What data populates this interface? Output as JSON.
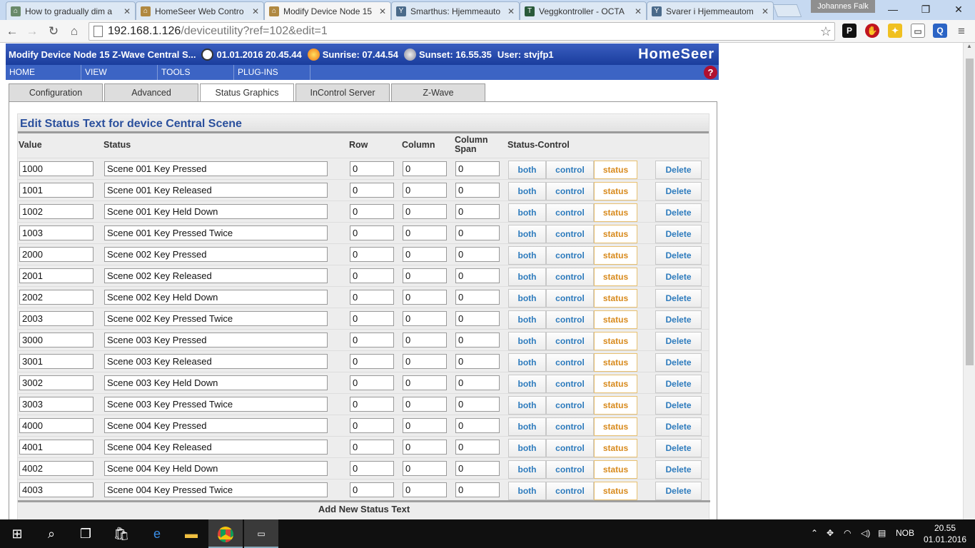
{
  "browser": {
    "tabs": [
      {
        "title": "How to gradually dim a",
        "icon": "homeseer-board-icon"
      },
      {
        "title": "HomeSeer Web Contro",
        "icon": "homeseer-house-icon"
      },
      {
        "title": "Modify Device Node 15",
        "icon": "homeseer-house-icon",
        "active": true
      },
      {
        "title": "Smarthus: Hjemmeauto",
        "icon": "smarthus-icon"
      },
      {
        "title": "Veggkontroller - OCTA",
        "icon": "veggkontroller-icon"
      },
      {
        "title": "Svarer i Hjemmeautom",
        "icon": "smarthus-icon"
      }
    ],
    "user": "Johannes Falk",
    "url_host": "192.168.1.126",
    "url_path": "/deviceutility?ref=102&edit=1"
  },
  "header": {
    "title": "Modify Device Node 15 Z-Wave Central S...",
    "datetime": "01.01.2016 20.45.44",
    "sunrise": "Sunrise: 07.44.54",
    "sunset": "Sunset: 16.55.35",
    "user": "User: stvjfp1",
    "logo": "HomeSeer"
  },
  "menu": [
    "HOME",
    "VIEW",
    "TOOLS",
    "PLUG-INS"
  ],
  "page_tabs": [
    "Configuration",
    "Advanced",
    "Status Graphics",
    "InControl Server",
    "Z-Wave"
  ],
  "section": {
    "title": "Edit Status Text for device Central Scene",
    "columns": {
      "value": "Value",
      "status": "Status",
      "row": "Row",
      "column": "Column",
      "column_span_1": "Column",
      "column_span_2": "Span",
      "status_control": "Status-Control"
    },
    "buttons": {
      "both": "both",
      "control": "control",
      "status": "status",
      "delete": "Delete"
    },
    "rows": [
      {
        "value": "1000",
        "status": "Scene 001 Key Pressed",
        "row": "0",
        "column": "0",
        "span": "0"
      },
      {
        "value": "1001",
        "status": "Scene 001 Key Released",
        "row": "0",
        "column": "0",
        "span": "0"
      },
      {
        "value": "1002",
        "status": "Scene 001 Key Held Down",
        "row": "0",
        "column": "0",
        "span": "0"
      },
      {
        "value": "1003",
        "status": "Scene 001 Key Pressed Twice",
        "row": "0",
        "column": "0",
        "span": "0"
      },
      {
        "value": "2000",
        "status": "Scene 002 Key Pressed",
        "row": "0",
        "column": "0",
        "span": "0"
      },
      {
        "value": "2001",
        "status": "Scene 002 Key Released",
        "row": "0",
        "column": "0",
        "span": "0"
      },
      {
        "value": "2002",
        "status": "Scene 002 Key Held Down",
        "row": "0",
        "column": "0",
        "span": "0"
      },
      {
        "value": "2003",
        "status": "Scene 002 Key Pressed Twice",
        "row": "0",
        "column": "0",
        "span": "0"
      },
      {
        "value": "3000",
        "status": "Scene 003 Key Pressed",
        "row": "0",
        "column": "0",
        "span": "0"
      },
      {
        "value": "3001",
        "status": "Scene 003 Key Released",
        "row": "0",
        "column": "0",
        "span": "0"
      },
      {
        "value": "3002",
        "status": "Scene 003 Key Held Down",
        "row": "0",
        "column": "0",
        "span": "0"
      },
      {
        "value": "3003",
        "status": "Scene 003 Key Pressed Twice",
        "row": "0",
        "column": "0",
        "span": "0"
      },
      {
        "value": "4000",
        "status": "Scene 004 Key Pressed",
        "row": "0",
        "column": "0",
        "span": "0"
      },
      {
        "value": "4001",
        "status": "Scene 004 Key Released",
        "row": "0",
        "column": "0",
        "span": "0"
      },
      {
        "value": "4002",
        "status": "Scene 004 Key Held Down",
        "row": "0",
        "column": "0",
        "span": "0"
      },
      {
        "value": "4003",
        "status": "Scene 004 Key Pressed Twice",
        "row": "0",
        "column": "0",
        "span": "0"
      }
    ],
    "add_new": "Add New Status Text"
  },
  "taskbar": {
    "lang": "NOB",
    "time": "20.55",
    "date": "01.01.2016"
  },
  "colors": {
    "header_blue": "#1a3d9d",
    "menu_blue": "#3c64c4",
    "link_blue": "#2d7bbd",
    "status_orange": "#d88a1c"
  }
}
